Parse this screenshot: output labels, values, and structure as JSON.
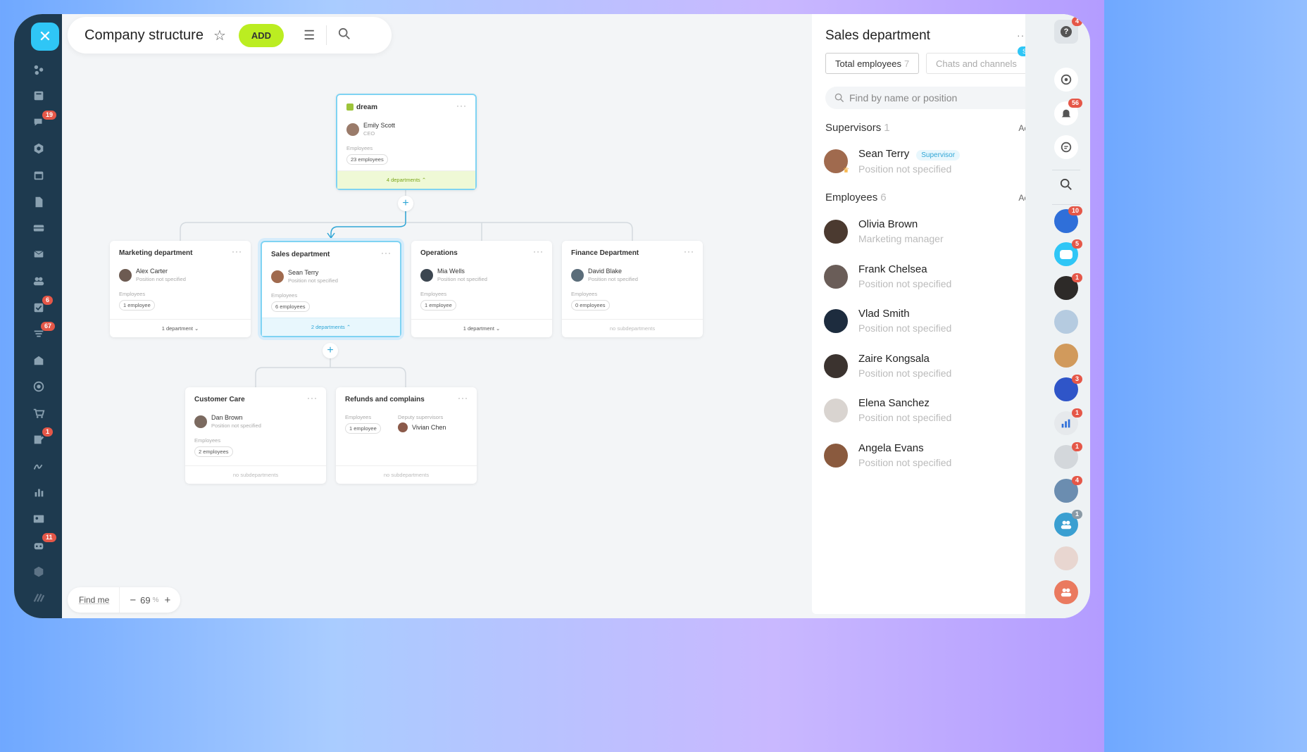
{
  "header": {
    "title": "Company structure",
    "add_label": "ADD"
  },
  "left_nav": {
    "badges": {
      "chat": "19",
      "tasks": "6",
      "filter": "67",
      "edit": "1",
      "bot": "11"
    }
  },
  "root": {
    "name": "dream",
    "head_name": "Emily Scott",
    "head_pos": "CEO",
    "emp_label": "Employees",
    "emp_count": "23 employees",
    "foot": "4 departments"
  },
  "departments": [
    {
      "name": "Marketing department",
      "head": "Alex Carter",
      "pos": "Position not specified",
      "emp_label": "Employees",
      "count": "1 employee",
      "foot": "1 department"
    },
    {
      "name": "Sales department",
      "head": "Sean Terry",
      "pos": "Position not specified",
      "emp_label": "Employees",
      "count": "6 employees",
      "foot": "2 departments"
    },
    {
      "name": "Operations",
      "head": "Mia Wells",
      "pos": "Position not specified",
      "emp_label": "Employees",
      "count": "1 employee",
      "foot": "1 department"
    },
    {
      "name": "Finance Department",
      "head": "David Blake",
      "pos": "Position not specified",
      "emp_label": "Employees",
      "count": "0 employees",
      "foot": "no subdepartments"
    }
  ],
  "subdepartments": [
    {
      "name": "Customer Care",
      "head": "Dan Brown",
      "pos": "Position not specified",
      "emp_label": "Employees",
      "count": "2 employees",
      "foot": "no subdepartments"
    },
    {
      "name": "Refunds and complains",
      "emp_label": "Employees",
      "count": "1 employee",
      "deputy_label": "Deputy supervisors",
      "deputy": "Vivian Chen",
      "foot": "no subdepartments"
    }
  ],
  "bottom": {
    "find_me": "Find me",
    "zoom": "69",
    "zoom_unit": "%"
  },
  "panel": {
    "title": "Sales department",
    "tab_total": "Total employees",
    "tab_total_count": "7",
    "tab_chats": "Chats and channels",
    "soon": "Soon",
    "search_placeholder": "Find by name or position",
    "supervisors_label": "Supervisors",
    "supervisors_count": "1",
    "actions": "Actions",
    "supervisor": {
      "name": "Sean Terry",
      "tag": "Supervisor",
      "pos": "Position not specified"
    },
    "employees_label": "Employees",
    "employees_count": "6",
    "employees": [
      {
        "name": "Olivia Brown",
        "pos": "Marketing manager"
      },
      {
        "name": "Frank Chelsea",
        "pos": "Position not specified"
      },
      {
        "name": "Vlad Smith",
        "pos": "Position not specified"
      },
      {
        "name": "Zaire Kongsala",
        "pos": "Position not specified"
      },
      {
        "name": "Elena Sanchez",
        "pos": "Position not specified"
      },
      {
        "name": "Angela Evans",
        "pos": "Position not specified"
      }
    ]
  },
  "right_bar": {
    "badges": {
      "help": "4",
      "bell": "56",
      "a1": "10",
      "a2": "5",
      "a3": "1",
      "a6": "3",
      "a7": "1",
      "a8": "1",
      "a9": "4",
      "a10": "1"
    }
  },
  "colors": {
    "accent": "#2fc6f6",
    "add_button": "#bbed21",
    "badge": "#e55748",
    "sidebar": "#1e3a4f"
  }
}
